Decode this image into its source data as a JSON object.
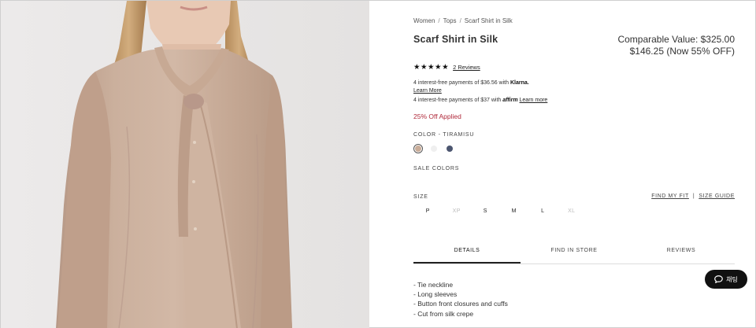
{
  "breadcrumb": [
    "Women",
    "Tops",
    "Scarf Shirt in Silk"
  ],
  "breadcrumb_separator": "/",
  "product": {
    "title": "Scarf Shirt in Silk",
    "comparable_value": "Comparable Value: $325.00",
    "sale_price": "$146.25 (Now 55% OFF)",
    "rating_stars": "★★★★★",
    "reviews_link": "2 Reviews",
    "discount_applied": "25% Off Applied"
  },
  "payments": {
    "klarna_text": "4 interest-free payments of $36.56 with",
    "klarna_brand": "Klarna.",
    "klarna_learn_more": "Learn More",
    "affirm_text": "4 interest-free payments of $37 with",
    "affirm_brand": "affirm",
    "affirm_learn_more": "Learn more"
  },
  "color": {
    "label": "COLOR - TIRAMISU",
    "swatches": [
      {
        "color": "#c9ac98",
        "selected": true
      },
      {
        "color": "#efefef",
        "selected": false
      },
      {
        "color": "#4c5670",
        "selected": false
      }
    ],
    "sale_colors_label": "SALE COLORS"
  },
  "size": {
    "label": "SIZE",
    "find_my_fit": "FIND MY FIT",
    "divider": "|",
    "size_guide": "SIZE GUIDE",
    "options": [
      {
        "label": "P",
        "available": true
      },
      {
        "label": "XP",
        "available": false
      },
      {
        "label": "S",
        "available": true
      },
      {
        "label": "M",
        "available": true
      },
      {
        "label": "L",
        "available": true
      },
      {
        "label": "XL",
        "available": false
      }
    ]
  },
  "tabs": [
    {
      "label": "DETAILS",
      "active": true
    },
    {
      "label": "FIND IN STORE",
      "active": false
    },
    {
      "label": "REVIEWS",
      "active": false
    }
  ],
  "details": [
    "- Tie neckline",
    "- Long sleeves",
    "- Button front closures and cuffs",
    "- Cut from silk crepe"
  ],
  "chat_button": {
    "label": "채팅",
    "icon": "chat-bubble-icon"
  },
  "colors": {
    "discount": "#b0293a",
    "blouse": "#c7ab96",
    "accent": "#111111"
  }
}
